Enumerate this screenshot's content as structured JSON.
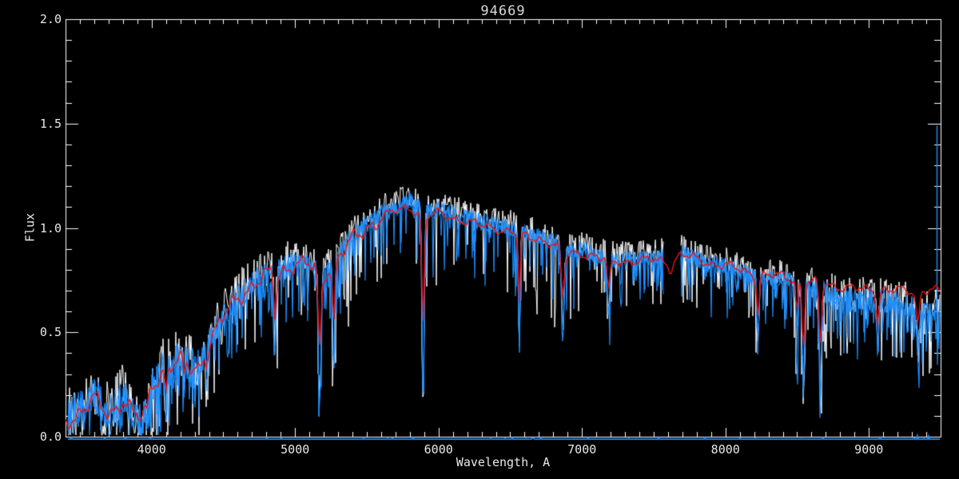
{
  "title": "94669",
  "axes": {
    "xlabel": "Wavelength, A",
    "ylabel": "Flux",
    "x_ticks": [
      4000,
      5000,
      6000,
      7000,
      8000,
      9000
    ],
    "y_ticks": [
      0.0,
      0.5,
      1.0,
      1.5,
      2.0
    ],
    "y_tick_labels": [
      "0.0",
      "0.5",
      "1.0",
      "1.5",
      "2.0"
    ],
    "x_minor_step": 100,
    "y_minor_step": 0.1,
    "frame_color": "#ffffff",
    "text_color": "#e8e8e8"
  },
  "colors": {
    "background": "#000000",
    "observed_blue": "#1e90ff",
    "observed_white": "#ffffff",
    "template_red": "#ee1111"
  },
  "chart_data": {
    "type": "line",
    "title": "94669",
    "xlabel": "Wavelength, A",
    "ylabel": "Flux",
    "xlim": [
      3400,
      9500
    ],
    "ylim": [
      0.0,
      2.0
    ],
    "grid": false,
    "legend": "none",
    "x": [
      3400,
      3500,
      3600,
      3700,
      3800,
      3900,
      4000,
      4100,
      4200,
      4300,
      4400,
      4500,
      4600,
      4700,
      4800,
      4900,
      5000,
      5100,
      5200,
      5300,
      5400,
      5500,
      5600,
      5700,
      5800,
      5900,
      6000,
      6100,
      6200,
      6300,
      6400,
      6500,
      6600,
      6700,
      6800,
      6900,
      7000,
      7100,
      7200,
      7300,
      7400,
      7500,
      7600,
      7700,
      7800,
      7900,
      8000,
      8100,
      8200,
      8300,
      8400,
      8500,
      8600,
      8700,
      8800,
      8900,
      9000,
      9100,
      9200,
      9300,
      9400,
      9500
    ],
    "series": [
      {
        "name": "observed-spectrum-blue",
        "color": "#1e90ff",
        "y": [
          0.1,
          0.13,
          0.2,
          0.11,
          0.2,
          0.08,
          0.24,
          0.34,
          0.37,
          0.33,
          0.46,
          0.58,
          0.68,
          0.73,
          0.78,
          0.8,
          0.84,
          0.83,
          0.79,
          0.88,
          0.96,
          1.02,
          1.07,
          1.1,
          1.13,
          1.07,
          1.09,
          1.07,
          1.05,
          1.03,
          1.01,
          1.0,
          0.97,
          0.96,
          0.93,
          0.89,
          0.89,
          0.87,
          0.85,
          0.85,
          0.85,
          0.86,
          0.87,
          0.88,
          0.85,
          0.82,
          0.82,
          0.79,
          0.77,
          0.76,
          0.76,
          0.74,
          0.72,
          0.68,
          0.66,
          0.65,
          0.66,
          0.67,
          0.64,
          0.62,
          0.6,
          0.6
        ]
      },
      {
        "name": "observed-spectrum-white",
        "color": "#ffffff",
        "y": [
          0.1,
          0.13,
          0.2,
          0.11,
          0.2,
          0.08,
          0.24,
          0.34,
          0.37,
          0.33,
          0.46,
          0.58,
          0.68,
          0.73,
          0.78,
          0.8,
          0.84,
          0.83,
          0.79,
          0.88,
          0.96,
          1.02,
          1.07,
          1.1,
          1.13,
          1.07,
          1.09,
          1.07,
          1.05,
          1.03,
          1.01,
          1.0,
          0.97,
          0.96,
          0.93,
          0.89,
          0.89,
          0.87,
          0.85,
          0.85,
          0.85,
          0.86,
          0.87,
          0.88,
          0.85,
          0.82,
          0.82,
          0.79,
          0.77,
          0.76,
          0.76,
          0.74,
          0.72,
          0.68,
          0.66,
          0.65,
          0.66,
          0.67,
          0.64,
          0.62,
          0.6,
          0.6
        ]
      },
      {
        "name": "template-fit-red",
        "color": "#ee1111",
        "y": [
          0.07,
          0.12,
          0.18,
          0.1,
          0.18,
          0.09,
          0.25,
          0.33,
          0.36,
          0.32,
          0.45,
          0.57,
          0.67,
          0.72,
          0.77,
          0.79,
          0.83,
          0.82,
          0.78,
          0.86,
          0.94,
          1.0,
          1.05,
          1.08,
          1.1,
          1.05,
          1.07,
          1.05,
          1.03,
          1.01,
          1.0,
          0.98,
          0.96,
          0.95,
          0.92,
          0.88,
          0.88,
          0.86,
          0.84,
          0.84,
          0.84,
          0.85,
          0.84,
          0.87,
          0.85,
          0.83,
          0.82,
          0.8,
          0.78,
          0.77,
          0.77,
          0.75,
          0.74,
          0.73,
          0.72,
          0.71,
          0.7,
          0.71,
          0.7,
          0.69,
          0.71,
          0.7
        ]
      }
    ],
    "absorption_lines": [
      {
        "wavelength": 3933,
        "min_flux": 0.03,
        "sigma": 10
      },
      {
        "wavelength": 3968,
        "min_flux": 0.05,
        "sigma": 8
      },
      {
        "wavelength": 4101,
        "min_flux": 0.15,
        "sigma": 7
      },
      {
        "wavelength": 4226,
        "min_flux": 0.24,
        "sigma": 6
      },
      {
        "wavelength": 4340,
        "min_flux": 0.28,
        "sigma": 6
      },
      {
        "wavelength": 4383,
        "min_flux": 0.3,
        "sigma": 6
      },
      {
        "wavelength": 4861,
        "min_flux": 0.45,
        "sigma": 7
      },
      {
        "wavelength": 5172,
        "min_flux": 0.18,
        "sigma": 9
      },
      {
        "wavelength": 5270,
        "min_flux": 0.34,
        "sigma": 7
      },
      {
        "wavelength": 5893,
        "min_flux": 0.16,
        "sigma": 7
      },
      {
        "wavelength": 6563,
        "min_flux": 0.4,
        "sigma": 6
      },
      {
        "wavelength": 6867,
        "min_flux": 0.52,
        "sigma": 10
      },
      {
        "wavelength": 7186,
        "min_flux": 0.58,
        "sigma": 8
      },
      {
        "wavelength": 7620,
        "min_flux": 0.78,
        "sigma": 14
      },
      {
        "wavelength": 8227,
        "min_flux": 0.45,
        "sigma": 7
      },
      {
        "wavelength": 8498,
        "min_flux": 0.48,
        "sigma": 6
      },
      {
        "wavelength": 8543,
        "min_flux": 0.19,
        "sigma": 7
      },
      {
        "wavelength": 8662,
        "min_flux": 0.21,
        "sigma": 7
      },
      {
        "wavelength": 9061,
        "min_flux": 0.45,
        "sigma": 8
      },
      {
        "wavelength": 9340,
        "min_flux": 0.42,
        "sigma": 9
      }
    ],
    "gaps": [
      [
        7572,
        7688
      ]
    ],
    "emission_spike": {
      "wavelength": 9470,
      "peak_flux": 1.49
    },
    "zero_line_flux": -0.01,
    "noise": {
      "white_offset": 0.03,
      "white_noise_scale": 1.4
    }
  }
}
